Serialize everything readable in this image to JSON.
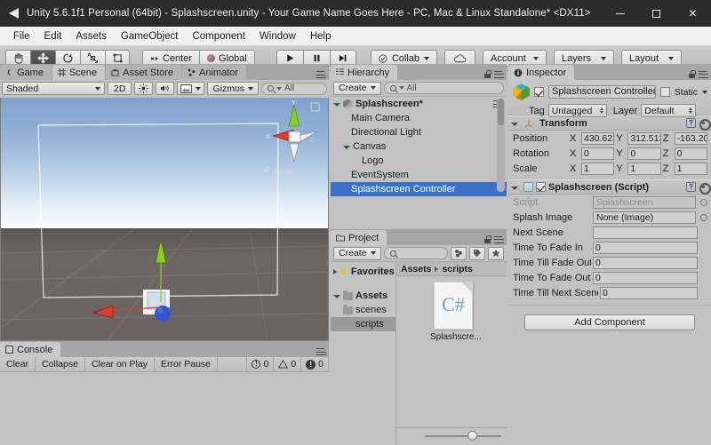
{
  "window": {
    "title": "Unity 5.6.1f1 Personal (64bit) - Splashscreen.unity - Your Game Name Goes Here - PC, Mac & Linux Standalone* <DX11>",
    "minimize_label": "–",
    "maximize_label": "□",
    "close_label": "✕",
    "logo_icon": "unity-logo-icon"
  },
  "menubar": {
    "items": [
      {
        "label": "File"
      },
      {
        "label": "Edit"
      },
      {
        "label": "Assets"
      },
      {
        "label": "GameObject"
      },
      {
        "label": "Component"
      },
      {
        "label": "Window"
      },
      {
        "label": "Help"
      }
    ]
  },
  "toolbar": {
    "transform_tools": [
      {
        "name": "hand-tool",
        "icon": "hand-icon",
        "active": false
      },
      {
        "name": "move-tool",
        "icon": "move-arrows-icon",
        "active": true
      },
      {
        "name": "rotate-tool",
        "icon": "rotate-icon",
        "active": false
      },
      {
        "name": "scale-tool",
        "icon": "scale-icon",
        "active": false
      },
      {
        "name": "rect-tool",
        "icon": "rect-transform-icon",
        "active": false
      }
    ],
    "pivot_label": "Center",
    "pivot_icon": "pivot-center-icon",
    "space_label": "Global",
    "space_icon": "global-sphere-icon",
    "play_label": "▶",
    "pause_label": "❘❘",
    "step_label": "▶❘",
    "collab_label": "Collab",
    "collab_icon": "collab-check-icon",
    "cloud_icon": "cloud-icon",
    "account_label": "Account",
    "layers_label": "Layers",
    "layout_label": "Layout"
  },
  "scene_panel": {
    "tabs": [
      {
        "label": "Game",
        "icon": "game-pad-icon",
        "selected": false
      },
      {
        "label": "Scene",
        "icon": "scene-grid-icon",
        "selected": true
      },
      {
        "label": "Asset Store",
        "icon": "asset-store-icon",
        "selected": false
      },
      {
        "label": "Animator",
        "icon": "animator-icon",
        "selected": false
      }
    ],
    "draw_mode": "Shaded",
    "toggle_2d": "2D",
    "lighting_icon": "sun-icon",
    "audio_icon": "speaker-icon",
    "effects_icon": "image-effects-icon",
    "gizmos_label": "Gizmos",
    "search_placeholder": "All",
    "gizmo_axes": {
      "x": "X",
      "y": "Y",
      "z": "Z"
    },
    "gizmo_mode": "Persp"
  },
  "hierarchy": {
    "tab_label": "Hierarchy",
    "tab_icon": "hierarchy-icon",
    "create_label": "Create",
    "search_placeholder": "All",
    "items": [
      {
        "label": "Splashscreen*",
        "depth": 0,
        "expanded": true,
        "selected": false,
        "icon": "scene-icon"
      },
      {
        "label": "Main Camera",
        "depth": 1,
        "expanded": null,
        "selected": false
      },
      {
        "label": "Directional Light",
        "depth": 1,
        "expanded": null,
        "selected": false
      },
      {
        "label": "Canvas",
        "depth": 1,
        "expanded": true,
        "selected": false
      },
      {
        "label": "Logo",
        "depth": 2,
        "expanded": null,
        "selected": false
      },
      {
        "label": "EventSystem",
        "depth": 1,
        "expanded": null,
        "selected": false
      },
      {
        "label": "Splashscreen Controller",
        "depth": 1,
        "expanded": null,
        "selected": true
      }
    ]
  },
  "inspector": {
    "tab_label": "Inspector",
    "tab_icon": "inspector-info-icon",
    "object_name": "Splashscreen Controller",
    "object_enabled": true,
    "static_label": "Static",
    "static_checked": false,
    "tag_label": "Tag",
    "tag_value": "Untagged",
    "layer_label": "Layer",
    "layer_value": "Default",
    "transform": {
      "title": "Transform",
      "icon": "transform-axis-icon",
      "enabled": true,
      "rows": [
        {
          "label": "Position",
          "x": "430.623",
          "y": "312.513",
          "z": "-163.20"
        },
        {
          "label": "Rotation",
          "x": "0",
          "y": "0",
          "z": "0"
        },
        {
          "label": "Scale",
          "x": "1",
          "y": "1",
          "z": "1"
        }
      ],
      "axis_labels": [
        "X",
        "Y",
        "Z"
      ]
    },
    "script_component": {
      "title": "Splashscreen (Script)",
      "icon": "cs-script-icon",
      "enabled": true,
      "fields": [
        {
          "label": "Script",
          "value": "Splashscreen",
          "dim": true,
          "has_picker": true
        },
        {
          "label": "Splash Image",
          "value": "None (Image)",
          "dim": false,
          "has_picker": true
        },
        {
          "label": "Next Scene",
          "value": "",
          "dim": false,
          "has_picker": false
        },
        {
          "label": "Time To Fade In",
          "value": "0",
          "dim": false,
          "has_picker": false
        },
        {
          "label": "Time Till Fade Out",
          "value": "0",
          "dim": false,
          "has_picker": false
        },
        {
          "label": "Time To Fade Out",
          "value": "0",
          "dim": false,
          "has_picker": false
        },
        {
          "label": "Time Till Next Scene",
          "value": "0",
          "dim": false,
          "has_picker": false
        }
      ]
    },
    "add_component_label": "Add Component"
  },
  "project": {
    "tab_label": "Project",
    "tab_icon": "project-folder-icon",
    "create_label": "Create",
    "search_placeholder": "",
    "favorites_label": "Favorites",
    "tree": [
      {
        "label": "Assets",
        "depth": 0,
        "expanded": true,
        "selected": false
      },
      {
        "label": "scenes",
        "depth": 1,
        "expanded": null,
        "selected": false
      },
      {
        "label": "scripts",
        "depth": 1,
        "expanded": null,
        "selected": true
      }
    ],
    "breadcrumb": [
      "Assets",
      "scripts"
    ],
    "assets": [
      {
        "label": "Splashscre...",
        "icon": "csharp-file-icon"
      }
    ]
  },
  "console": {
    "tab_label": "Console",
    "tab_icon": "console-icon",
    "buttons": [
      {
        "label": "Clear"
      },
      {
        "label": "Collapse"
      },
      {
        "label": "Clear on Play"
      },
      {
        "label": "Error Pause"
      }
    ],
    "counts": [
      {
        "icon": "info-icon",
        "value": "0"
      },
      {
        "icon": "warning-icon",
        "value": "0"
      },
      {
        "icon": "error-icon",
        "value": "0"
      }
    ]
  },
  "colors": {
    "selection_blue": "#3a72c9",
    "panel_gray": "#c2c2c2",
    "titlebar_dark": "#2b2b2b",
    "gizmo_x": "#e03c2c",
    "gizmo_y": "#8ccc28",
    "gizmo_z": "#3a6fe0"
  }
}
